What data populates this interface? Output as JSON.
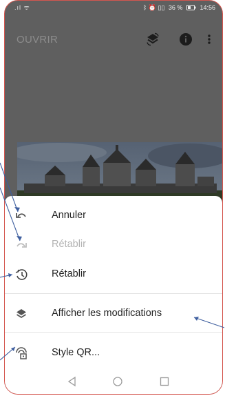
{
  "status_bar": {
    "signal_text": ".ıl ᯤ",
    "indicators_text": "ᛒ ⏰ ▯▯",
    "battery_text": "36 %",
    "time": "14:56"
  },
  "app_bar": {
    "title": "OUVRIR",
    "actions": [
      "layers-icon",
      "info-icon",
      "more-vert-icon"
    ]
  },
  "menu": {
    "items": [
      {
        "label": "Annuler",
        "icon": "undo-icon",
        "enabled": true
      },
      {
        "label": "Rétablir",
        "icon": "redo-icon",
        "enabled": false
      },
      {
        "label": "Rétablir",
        "icon": "restore-history-icon",
        "enabled": true
      },
      {
        "label": "Afficher les modifications",
        "icon": "layers-icon",
        "enabled": true
      },
      {
        "label": "Style QR...",
        "icon": "qr-style-icon",
        "enabled": true
      }
    ]
  },
  "nav_bar": {
    "buttons": [
      "back-icon",
      "home-icon",
      "recents-icon"
    ]
  },
  "colors": {
    "dim_overlay": "#5f5f5f",
    "annotation_arrow": "#3f5f9f",
    "frame_outline": "#d4564f"
  }
}
